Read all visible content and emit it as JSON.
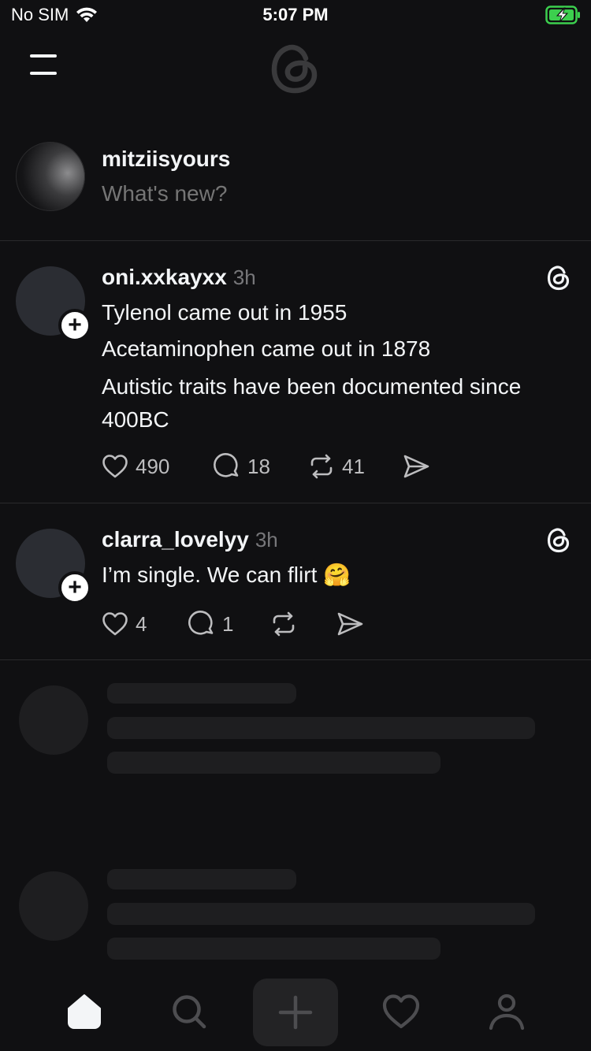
{
  "status": {
    "carrier": "No SIM",
    "time": "5:07 PM"
  },
  "composer": {
    "username": "mitziisyours",
    "placeholder": "What's new?"
  },
  "posts": [
    {
      "username": "oni.xxkayxx",
      "time": "3h",
      "lines": [
        "Tylenol came out in 1955",
        "Acetaminophen came out in 1878",
        "Autistic traits have been documented since 400BC"
      ],
      "likes": "490",
      "replies": "18",
      "reposts": "41"
    },
    {
      "username": "clarra_lovelyy",
      "time": "3h",
      "text": "I’m single. We can flirt 🤗",
      "likes": "4",
      "replies": "1",
      "reposts": ""
    }
  ],
  "nav": {
    "items": [
      "home-icon",
      "search-icon",
      "create-icon",
      "activity-icon",
      "profile-icon"
    ],
    "active": "home-icon"
  },
  "colors": {
    "background": "#101012",
    "text": "#f3f5f7",
    "muted": "#77777a",
    "skeleton": "#1e1e20"
  }
}
